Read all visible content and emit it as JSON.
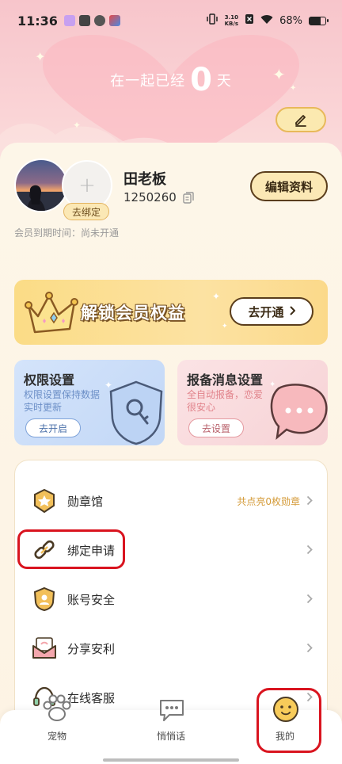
{
  "status_bar": {
    "time": "11:36",
    "network_speed_value": "3.10",
    "network_speed_unit": "KB/s",
    "battery_percent": "68%",
    "battery_level": 0.68
  },
  "together": {
    "prefix": "在一起已经",
    "days": "0",
    "suffix": "天"
  },
  "profile": {
    "nickname": "田老板",
    "user_id": "1250260",
    "bind_label": "去绑定",
    "add_partner_symbol": "+",
    "edit_button": "编辑资料",
    "member_expire": "会员到期时间：尚未开通"
  },
  "vip_banner": {
    "title": "解锁会员权益",
    "button": "去开通"
  },
  "feature_cards": [
    {
      "title": "权限设置",
      "desc": "权限设置保持数据实时更新",
      "button": "去开启"
    },
    {
      "title": "报备消息设置",
      "desc": "全自动报备，恋爱很安心",
      "button": "去设置"
    }
  ],
  "menu": [
    {
      "label": "勋章馆",
      "extra": "共点亮0枚勋章",
      "icon": "medal-icon"
    },
    {
      "label": "绑定申请",
      "extra": "",
      "icon": "link-icon"
    },
    {
      "label": "账号安全",
      "extra": "",
      "icon": "shield-user-icon"
    },
    {
      "label": "分享安利",
      "extra": "",
      "icon": "envelope-icon"
    },
    {
      "label": "在线客服",
      "extra": "",
      "icon": "headset-icon"
    }
  ],
  "bottom_nav": [
    {
      "label": "宠物",
      "icon": "paw-icon"
    },
    {
      "label": "悄悄话",
      "icon": "chat-bubble-icon"
    },
    {
      "label": "我的",
      "icon": "smiley-icon"
    }
  ],
  "colors": {
    "accent_gold": "#e8b95a",
    "outline_red": "#d9141f",
    "pink_bg": "#f7c5cb",
    "cream_bg": "#fdf6e8"
  }
}
